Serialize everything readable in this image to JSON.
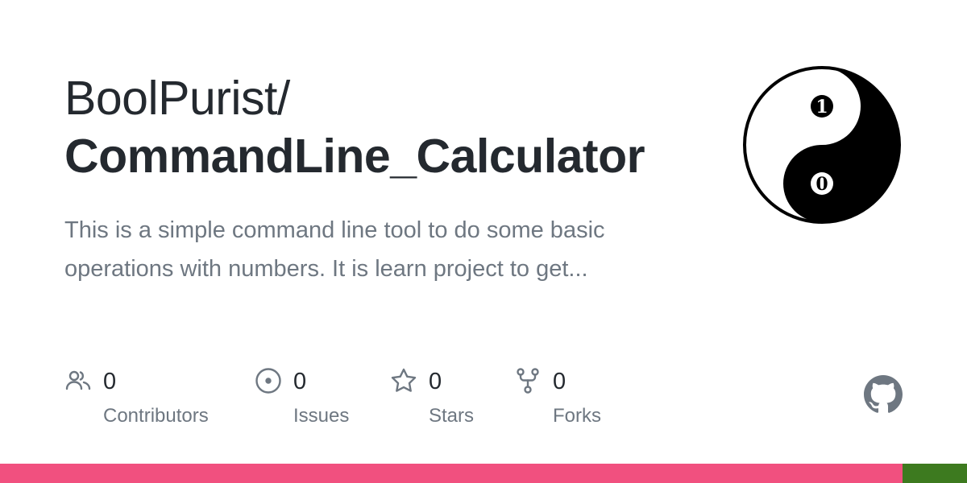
{
  "repo": {
    "owner": "BoolPurist/",
    "name": "CommandLine_Calculator",
    "description": "This is a simple command line tool to do some basic operations with numbers. It is learn project to get..."
  },
  "stats": [
    {
      "icon": "people-icon",
      "value": "0",
      "label": "Contributors"
    },
    {
      "icon": "issue-icon",
      "value": "0",
      "label": "Issues"
    },
    {
      "icon": "star-icon",
      "value": "0",
      "label": "Stars"
    },
    {
      "icon": "fork-icon",
      "value": "0",
      "label": "Forks"
    }
  ],
  "avatar": {
    "top_digit": "1",
    "bottom_digit": "0"
  },
  "colors": {
    "language_bar": [
      "#f1507f",
      "#3d7a1f"
    ],
    "muted": "#6e7781",
    "text": "#24292f"
  }
}
